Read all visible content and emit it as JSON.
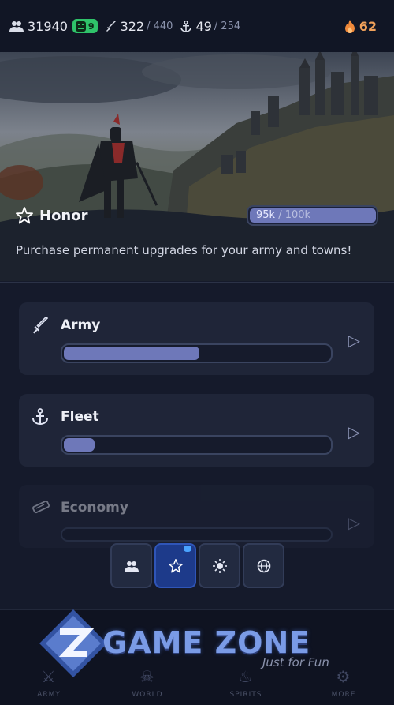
{
  "topbar": {
    "population": "31940",
    "happiness": "9",
    "army_current": "322",
    "army_max": "/ 440",
    "fleet_current": "49",
    "fleet_max": "/ 254",
    "fire": "62"
  },
  "hero": {
    "title": "Honor",
    "progress_current": "95k",
    "progress_max": " / 100k",
    "progress_fraction": 0.95,
    "description": "Purchase permanent upgrades for your army and towns!"
  },
  "upgrades": [
    {
      "label": "Army",
      "icon": "sword-icon",
      "progress": 0.51
    },
    {
      "label": "Fleet",
      "icon": "anchor-icon",
      "progress": 0.12
    },
    {
      "label": "Economy",
      "icon": "coins-icon",
      "progress": 0.0
    }
  ],
  "tabs": [
    {
      "icon": "people-icon",
      "glyph": "👥"
    },
    {
      "icon": "star-icon",
      "glyph": "☆"
    },
    {
      "icon": "sun-icon",
      "glyph": "✹"
    },
    {
      "icon": "globe-icon",
      "glyph": "◍"
    }
  ],
  "nav": [
    {
      "label": "ARMY",
      "icon": "army-icon"
    },
    {
      "label": "WORLD",
      "icon": "skull-icon"
    },
    {
      "label": "SPIRITS",
      "icon": "spirit-icon"
    },
    {
      "label": "MORE",
      "icon": "gear-icon"
    }
  ],
  "watermark": {
    "brand": "GAME ZONE",
    "tagline": "Just for Fun"
  },
  "colors": {
    "accent": "#6e78b9",
    "active_tab": "#1d3a8a",
    "happiness": "#2fc36a",
    "fire": "#f0a15a"
  }
}
